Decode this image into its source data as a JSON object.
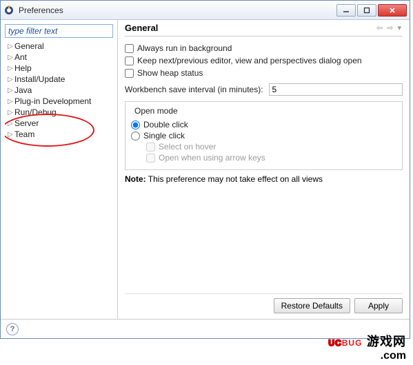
{
  "window": {
    "title": "Preferences"
  },
  "sidebar": {
    "filter_placeholder": "type filter text",
    "items": [
      {
        "label": "General"
      },
      {
        "label": "Ant"
      },
      {
        "label": "Help"
      },
      {
        "label": "Install/Update"
      },
      {
        "label": "Java"
      },
      {
        "label": "Plug-in Development"
      },
      {
        "label": "Run/Debug"
      },
      {
        "label": "Server"
      },
      {
        "label": "Team"
      }
    ]
  },
  "panel": {
    "heading": "General",
    "checkboxes": {
      "always_bg": "Always run in background",
      "keep_editor": "Keep next/previous editor, view and perspectives dialog open",
      "show_heap": "Show heap status"
    },
    "interval_label": "Workbench save interval (in minutes):",
    "interval_value": "5",
    "open_mode": {
      "legend": "Open mode",
      "dbl": "Double click",
      "sgl": "Single click",
      "hover": "Select on hover",
      "arrow": "Open when using arrow keys"
    },
    "note_prefix": "Note:",
    "note_text": " This preference may not take effect on all views"
  },
  "buttons": {
    "restore": "Restore Defaults",
    "apply": "Apply"
  },
  "watermark": {
    "brand": "UCBUG",
    "cn": "游戏网",
    "domain": ".com"
  }
}
